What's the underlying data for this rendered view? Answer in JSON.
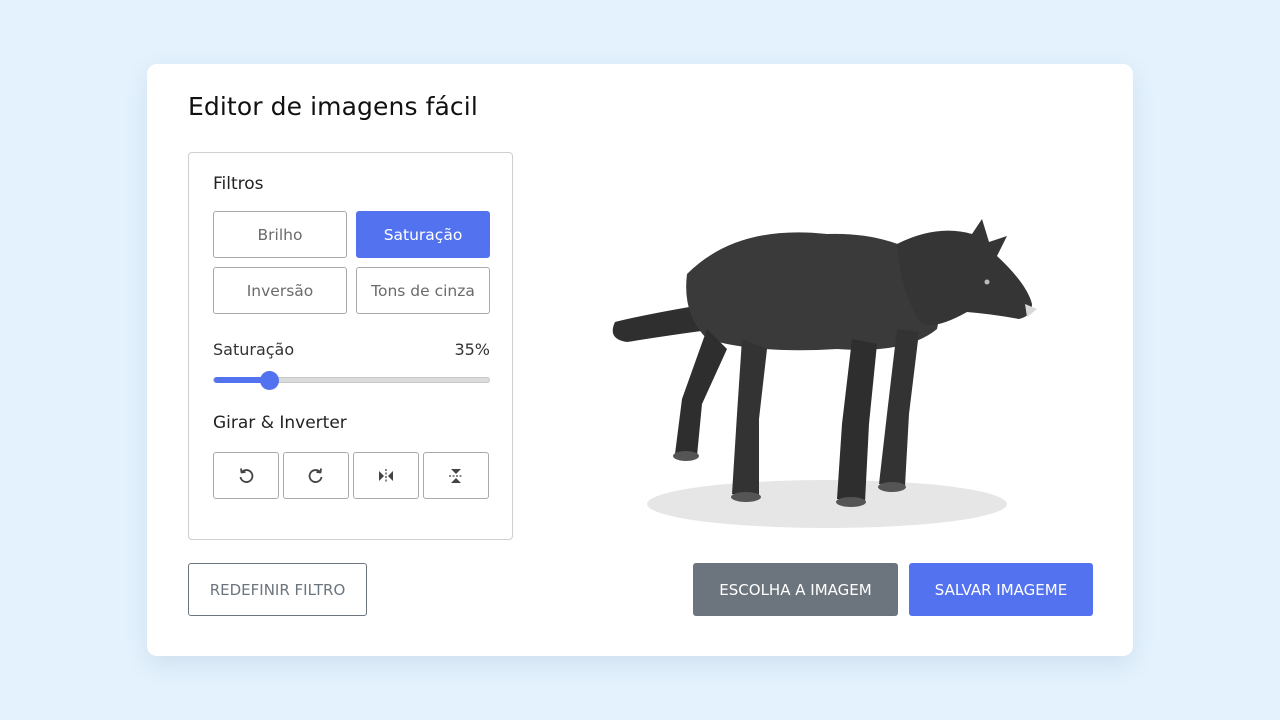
{
  "app": {
    "title": "Editor de imagens fácil"
  },
  "filters": {
    "heading": "Filtros",
    "buttons": [
      {
        "label": "Brilho",
        "active": false
      },
      {
        "label": "Saturação",
        "active": true
      },
      {
        "label": "Inversão",
        "active": false
      },
      {
        "label": "Tons de cinza",
        "active": false
      }
    ]
  },
  "slider": {
    "name": "Saturação",
    "value_text": "35%",
    "value": 0.2,
    "accent_color": "#5372f0"
  },
  "rotate": {
    "heading": "Girar & Inverter",
    "icons": [
      "rotate-left-icon",
      "rotate-right-icon",
      "flip-horizontal-icon",
      "flip-vertical-icon"
    ]
  },
  "actions": {
    "reset_label": "REDEFINIR FILTRO",
    "choose_label": "ESCOLHA A IMAGEM",
    "save_label": "SALVAR IMAGEME"
  },
  "preview": {
    "subject": "wolf-image"
  }
}
